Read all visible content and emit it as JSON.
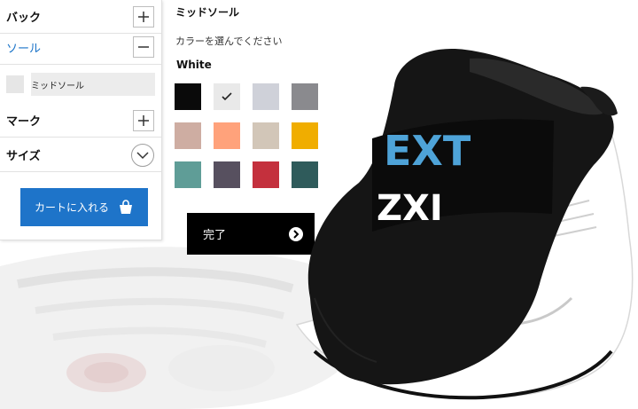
{
  "menu": {
    "items": [
      {
        "label": "バック",
        "control": "plus"
      },
      {
        "label": "ソール",
        "control": "minus",
        "active": true
      },
      {
        "label": "マーク",
        "control": "plus"
      },
      {
        "label": "サイズ",
        "control": "chevron-down"
      }
    ],
    "sub_item": {
      "label": "ミッドソール"
    },
    "cart_button": {
      "label": "カートに入れる",
      "icon": "shopping-bag-icon"
    }
  },
  "color_panel": {
    "title": "ミッドソール",
    "instruction": "カラーを選んでください",
    "selected_name": "White",
    "swatches": [
      {
        "color": "#0a0a0a"
      },
      {
        "color": "#e9e9e9",
        "selected": true
      },
      {
        "color": "#cfd1d9"
      },
      {
        "color": "#8a8a8e"
      },
      {
        "color": "#ceada2"
      },
      {
        "color": "#ffa27b"
      },
      {
        "color": "#d2c6b8"
      },
      {
        "color": "#f0ad00"
      },
      {
        "color": "#5f9d97"
      },
      {
        "color": "#57505f"
      },
      {
        "color": "#c4303d"
      },
      {
        "color": "#2f5b5b"
      }
    ],
    "done_button": {
      "label": "完了",
      "icon": "arrow-right-circle-icon"
    }
  },
  "product": {
    "band_text_top": "EXT",
    "band_text_bottom": "ZXI",
    "accent_color": "#1e74c9",
    "band_text_color": "#4ea3d8"
  }
}
